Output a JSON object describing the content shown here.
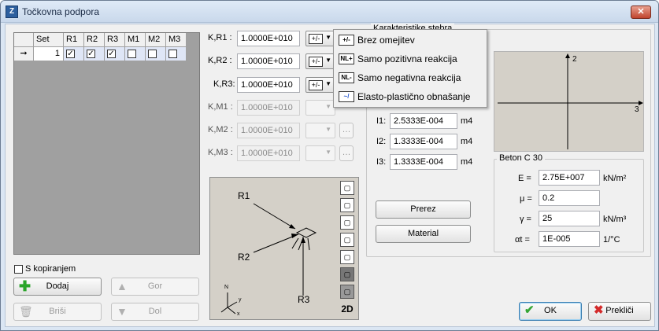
{
  "window": {
    "title": "Točkovna podpora",
    "close_label": "✕"
  },
  "grid": {
    "headers": [
      "",
      "Set",
      "R1",
      "R2",
      "R3",
      "M1",
      "M2",
      "M3"
    ],
    "row": {
      "marker": "➞",
      "set": "1",
      "checks": [
        "✓",
        "✓",
        "✓",
        "",
        "",
        ""
      ]
    }
  },
  "copy_checkbox_label": "S kopiranjem",
  "buttons": {
    "add": "Dodaj",
    "up": "Gor",
    "delete": "Briši",
    "down": "Dol",
    "ok": "OK",
    "cancel": "Prekliči",
    "section": "Prerez",
    "material": "Material",
    "ellipsis": "…"
  },
  "stiffness": [
    {
      "label": "K,R1 :",
      "value": "1.0000E+010",
      "enabled": true
    },
    {
      "label": "K,R2 :",
      "value": "1.0000E+010",
      "enabled": true
    },
    {
      "label": "K,R3:",
      "value": "1.0000E+010",
      "enabled": true
    },
    {
      "label": "K,M1 :",
      "value": "1.0000E+010",
      "enabled": false
    },
    {
      "label": "K,M2 :",
      "value": "1.0000E+010",
      "enabled": false
    },
    {
      "label": "K,M3 :",
      "value": "1.0000E+010",
      "enabled": false
    }
  ],
  "menu": {
    "items": [
      {
        "icon": "+/-",
        "label": "Brez omejitev"
      },
      {
        "icon": "NL+",
        "label": "Samo pozitivna reakcija"
      },
      {
        "icon": "NL-",
        "label": "Samo negativna reakcija"
      },
      {
        "icon": "~/",
        "label": "Elasto-plastično obnašanje"
      }
    ]
  },
  "column_props": {
    "title": "Karakteristike stebra",
    "inertia": [
      {
        "label": "I1:",
        "value": "2.5333E-004",
        "unit": "m4"
      },
      {
        "label": "I2:",
        "value": "1.3333E-004",
        "unit": "m4"
      },
      {
        "label": "I3:",
        "value": "1.3333E-004",
        "unit": "m4"
      }
    ],
    "axis2": "2",
    "axis3": "3"
  },
  "material": {
    "title": "Beton C 30",
    "rows": [
      {
        "label": "E =",
        "value": "2.75E+007",
        "unit": "kN/m²"
      },
      {
        "label": "μ =",
        "value": "0.2",
        "unit": ""
      },
      {
        "label": "γ =",
        "value": "25",
        "unit": "kN/m³"
      },
      {
        "label": "αt =",
        "value": "1E-005",
        "unit": "1/°C"
      }
    ]
  },
  "view3d": {
    "r1": "R1",
    "r2": "R2",
    "r3": "R3",
    "mode": "2D",
    "axis_n": "N",
    "axis_y": "y",
    "axis_x": "x"
  }
}
